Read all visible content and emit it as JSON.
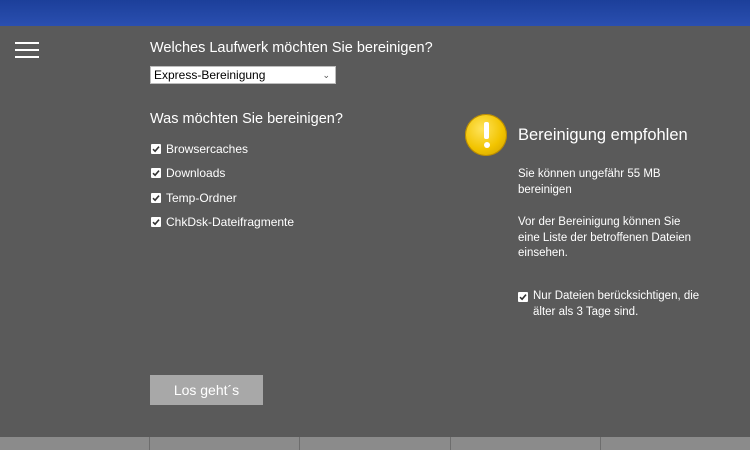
{
  "drive_section": {
    "heading": "Welches Laufwerk möchten Sie bereinigen?",
    "selected_option": "Express-Bereinigung"
  },
  "clean_section": {
    "heading": "Was möchten Sie bereinigen?",
    "items": [
      {
        "label": "Browsercaches",
        "checked": true
      },
      {
        "label": "Downloads",
        "checked": true
      },
      {
        "label": "Temp-Ordner",
        "checked": true
      },
      {
        "label": "ChkDsk-Dateifragmente",
        "checked": true
      }
    ]
  },
  "recommendation": {
    "icon": "warning-icon",
    "title": "Bereinigung empfohlen",
    "size_text": "Sie können ungefähr 55 MB bereinigen",
    "preview_text": "Vor der Bereinigung können Sie eine Liste der betroffenen Dateien einsehen.",
    "older_files_label": "Nur Dateien berücksichtigen, die älter als 3 Tage sind.",
    "older_files_checked": true
  },
  "actions": {
    "start_label": "Los geht´s"
  },
  "colors": {
    "background": "#5a5a5a",
    "titlebar": "#2a4fb0",
    "button": "#a8a8a8",
    "warning": "#f2c400"
  }
}
